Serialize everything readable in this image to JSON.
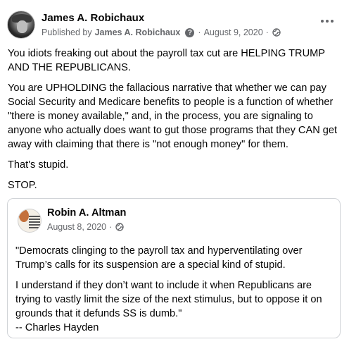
{
  "post": {
    "author": "James A. Robichaux",
    "published_prefix": "Published by",
    "publisher": "James A. Robichaux",
    "date_separator": "·",
    "date": "August 9, 2020",
    "paragraphs": [
      "You idiots freaking out about the payroll tax cut are HELPING TRUMP AND THE REPUBLICANS.",
      "You are UPHOLDING the fallacious narrative that whether we can pay Social Security and Medicare benefits to people is a function of whether \"there is money available,\" and, in the process, you are signaling to anyone who actually does want to gut those programs that they CAN get away with claiming that there is \"not enough money\" for them.",
      "That's stupid.",
      "STOP."
    ]
  },
  "shared_post": {
    "author": "Robin A. Altman",
    "date": "August 8, 2020",
    "date_separator": "·",
    "paragraphs": [
      "\"Democrats clinging to the payroll tax and hyperventilating over Trump’s calls for its suspension are a special kind of stupid.",
      "I understand if they don’t want to include it when Republicans are trying to vastly limit the size of the next stimulus, but to oppose it on grounds that it defunds SS is dumb.\"",
      "-- Charles Hayden"
    ]
  },
  "icons": {
    "privacy": "globe-icon",
    "help": "question-icon",
    "menu": "more-options-icon"
  },
  "colors": {
    "text": "#050505",
    "secondary": "#65676b",
    "border": "#d0d3d7"
  }
}
